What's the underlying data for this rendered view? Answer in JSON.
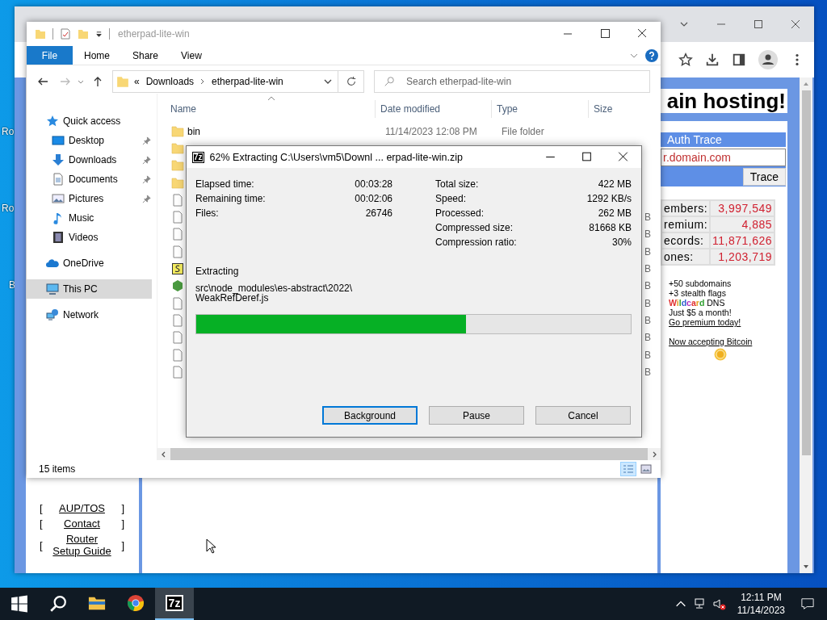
{
  "desktop": {
    "icons": [
      {
        "label": "Ro"
      },
      {
        "label": "Ro"
      },
      {
        "label": "B"
      }
    ]
  },
  "browser": {
    "page": {
      "heading": "ain hosting!",
      "trace": {
        "title": "Auth Trace",
        "value": "r.domain.com",
        "button": "Trace"
      },
      "stats": [
        {
          "label": "embers:",
          "value": "3,997,549"
        },
        {
          "label": "remium:",
          "value": "4,885"
        },
        {
          "label": "ecords:",
          "value": "11,871,626"
        },
        {
          "label": "ones:",
          "value": "1,203,719"
        }
      ],
      "promo": [
        {
          "kind": "text",
          "text": "+50 subdomains"
        },
        {
          "kind": "text",
          "text": "+3 stealth flags"
        },
        {
          "kind": "rainbow",
          "word": "Wildcard",
          "text": " DNS"
        },
        {
          "kind": "text",
          "text": "Just $5 a month!"
        },
        {
          "kind": "link",
          "text": "Go premium today!"
        }
      ],
      "bitcoin_link": "Now accepting Bitcoin",
      "footer_links": [
        {
          "open": "[",
          "label": "AUP/TOS",
          "close": "]"
        },
        {
          "open": "[",
          "label": "Contact",
          "close": "]"
        },
        {
          "open": "[",
          "label": "Router Setup Guide",
          "close": "]"
        }
      ]
    }
  },
  "explorer": {
    "title": "etherpad-lite-win",
    "file_tab": "File",
    "ribbon_tabs": [
      "Home",
      "Share",
      "View"
    ],
    "address": {
      "overflow": "«",
      "crumbs": [
        "Downloads",
        "etherpad-lite-win"
      ]
    },
    "search": {
      "placeholder": "Search etherpad-lite-win"
    },
    "columns": [
      "Name",
      "Date modified",
      "Type",
      "Size"
    ],
    "nav": [
      {
        "label": "Quick access",
        "kind": "star",
        "selected": false,
        "children": [
          {
            "label": "Desktop",
            "kind": "desktop",
            "pinned": true,
            "selected": false
          },
          {
            "label": "Downloads",
            "kind": "download",
            "pinned": true,
            "selected": false
          },
          {
            "label": "Documents",
            "kind": "documents",
            "pinned": true,
            "selected": false
          },
          {
            "label": "Pictures",
            "kind": "pictures",
            "pinned": true,
            "selected": false
          },
          {
            "label": "Music",
            "kind": "music",
            "pinned": false,
            "selected": false
          },
          {
            "label": "Videos",
            "kind": "videos",
            "pinned": false,
            "selected": false
          }
        ]
      },
      {
        "label": "OneDrive",
        "kind": "cloud",
        "selected": false
      },
      {
        "label": "This PC",
        "kind": "pc",
        "selected": true
      },
      {
        "label": "Network",
        "kind": "network",
        "selected": false
      }
    ],
    "files": [
      {
        "kind": "folder",
        "name": "bin",
        "date": "11/14/2023 12:08 PM",
        "type": "File folder"
      },
      {
        "kind": "folder"
      },
      {
        "kind": "folder"
      },
      {
        "kind": "folder"
      },
      {
        "kind": "file"
      },
      {
        "kind": "file",
        "size": "B"
      },
      {
        "kind": "file",
        "size": "B"
      },
      {
        "kind": "file",
        "size": "B"
      },
      {
        "kind": "script",
        "size": "B"
      },
      {
        "kind": "node",
        "size": "B"
      },
      {
        "kind": "file",
        "size": "B"
      },
      {
        "kind": "file",
        "size": "B"
      },
      {
        "kind": "file",
        "size": "B"
      },
      {
        "kind": "file",
        "size": "B"
      },
      {
        "kind": "file",
        "size": "B"
      }
    ],
    "status": "15 items",
    "views": [
      {
        "kind": "details",
        "selected": true
      },
      {
        "kind": "tiles",
        "selected": false
      }
    ]
  },
  "dialog": {
    "icon_text": "7z",
    "title": "62% Extracting C:\\Users\\vm5\\Downl ... erpad-lite-win.zip",
    "stats_left": [
      {
        "label": "Elapsed time:",
        "value": "00:03:28"
      },
      {
        "label": "Remaining time:",
        "value": "00:02:06"
      },
      {
        "label": "Files:",
        "value": "26746"
      }
    ],
    "stats_right": [
      {
        "label": "Total size:",
        "value": "422 MB"
      },
      {
        "label": "Speed:",
        "value": "1292 KB/s"
      },
      {
        "label": "Processed:",
        "value": "262 MB"
      },
      {
        "label": "Compressed size:",
        "value": "81668 KB"
      },
      {
        "label": "Compression ratio:",
        "value": "30%"
      }
    ],
    "action": "Extracting",
    "current_file": [
      "src\\node_modules\\es-abstract\\2022\\",
      "WeakRefDeref.js"
    ],
    "progress": {
      "level": 0.62
    },
    "buttons": [
      {
        "label": "Background",
        "focused": true
      },
      {
        "label": "Pause",
        "focused": false
      },
      {
        "label": "Cancel",
        "focused": false
      }
    ]
  },
  "taskbar": {
    "apps": [
      {
        "kind": "explorer",
        "active": false
      },
      {
        "kind": "chrome",
        "active": false
      },
      {
        "kind": "sevenzip",
        "active": true,
        "icon_text": "7z"
      }
    ],
    "time": "12:11 PM",
    "date": "11/14/2023"
  }
}
